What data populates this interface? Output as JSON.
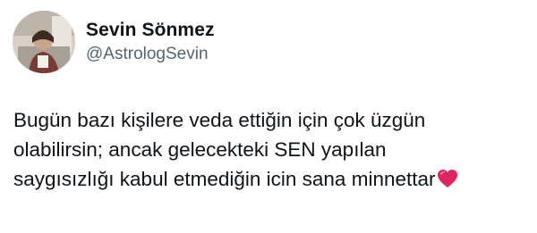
{
  "tweet": {
    "author": {
      "display_name": "Sevin Sönmez",
      "handle": "@AstrologSevin",
      "avatar_icon": "profile-photo"
    },
    "text_lines": [
      "Bugün bazı kişilere veda ettiğin için çok üzgün",
      "olabilirsin; ancak gelecekteki SEN yapılan",
      "saygısızlığı kabul etmediğin icin sana minnettar"
    ],
    "emoji": {
      "name": "red-heart-icon",
      "color": "#e0245e"
    }
  },
  "colors": {
    "background": "#ffffff",
    "text_primary": "#0f1419",
    "text_secondary": "#536471"
  }
}
